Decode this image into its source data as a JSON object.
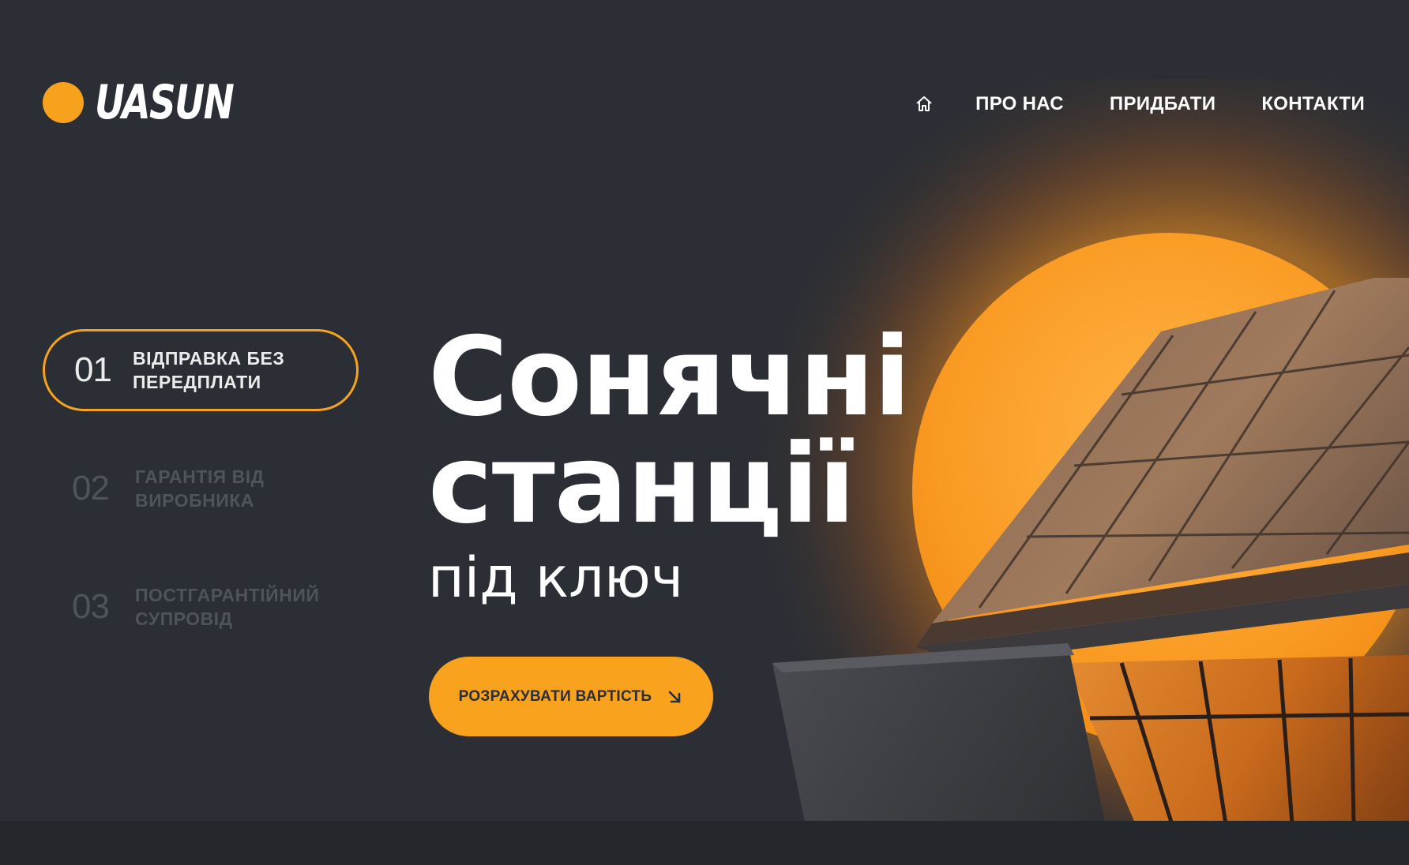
{
  "brand": {
    "name": "UASUN",
    "accent": "#f7a21c",
    "background": "#2b2e34"
  },
  "nav": {
    "home_icon": "home-icon",
    "links": [
      "ПРО НАС",
      "ПРИДБАТИ",
      "КОНТАКТИ"
    ]
  },
  "steps": [
    {
      "num": "01",
      "label": "ВІДПРАВКА БЕЗ ПЕРЕДПЛАТИ",
      "active": true
    },
    {
      "num": "02",
      "label": "ГАРАНТІЯ ВІД ВИРОБНИКА",
      "active": false
    },
    {
      "num": "03",
      "label": "ПОСТГАРАНТІЙНИЙ СУПРОВІД",
      "active": false
    }
  ],
  "hero": {
    "line1": "Сонячні",
    "line2": "станції",
    "subtitle": "під ключ"
  },
  "cta": {
    "label": "РОЗРАХУВАТИ ВАРТІСТЬ",
    "icon": "arrow-down-right-icon"
  }
}
